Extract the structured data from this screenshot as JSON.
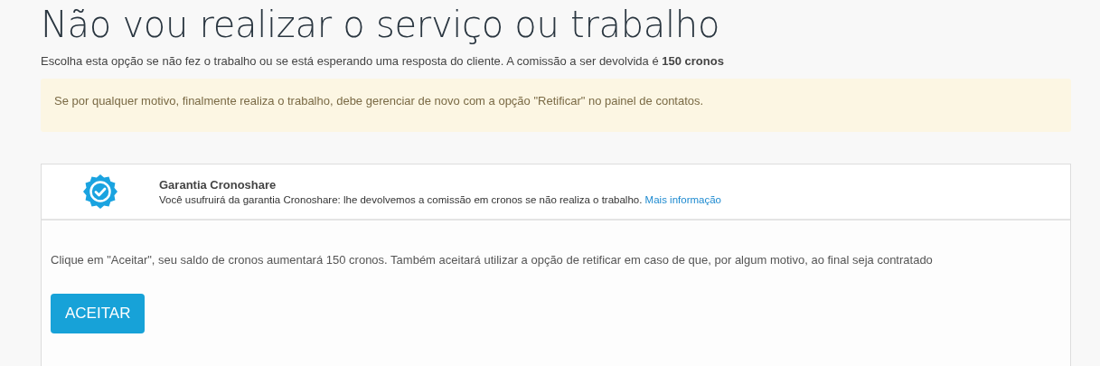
{
  "title": "Não vou realizar o serviço ou trabalho",
  "subtitle": "Escolha esta opção se não fez o trabalho ou se está esperando uma resposta do cliente. A comissão a ser devolvida é **150 cronos**",
  "notice": "Se por qualquer motivo, finalmente realiza o trabalho, debe gerenciar de novo com a opção \"Retificar\" no painel de contatos.",
  "guarantee": {
    "title": "Garantia Cronoshare",
    "description": "Você usufruirá da garantia Cronoshare: lhe devolvemos a comissão em cronos se não realiza o trabalho.",
    "link": "Mais informação"
  },
  "instructions": "Clique em \"Aceitar\", seu saldo de cronos aumentará 150 cronos. Também aceitará utilizar a opção de retificar em caso de que, por algum motivo, ao final seja contratado",
  "button": "ACEITAR"
}
